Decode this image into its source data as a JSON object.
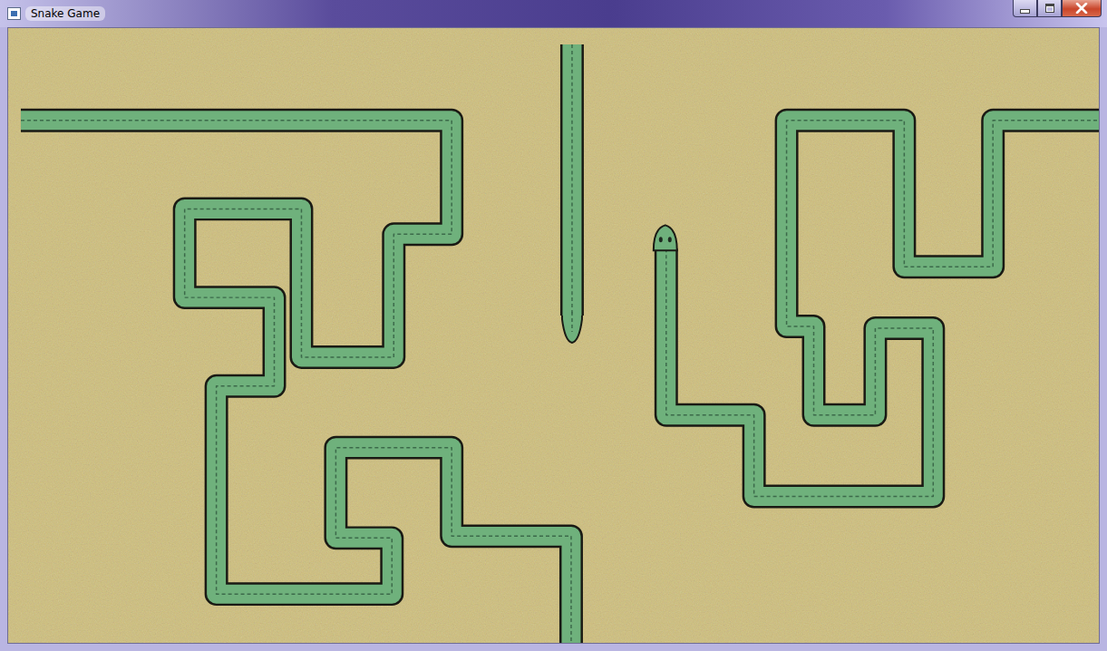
{
  "window": {
    "title": "Snake Game"
  },
  "snakes": [
    {
      "head_visible": false,
      "tail_visible": false
    },
    {
      "head_visible": false,
      "tail_visible": true
    },
    {
      "head_visible": true,
      "tail_visible": false
    }
  ]
}
